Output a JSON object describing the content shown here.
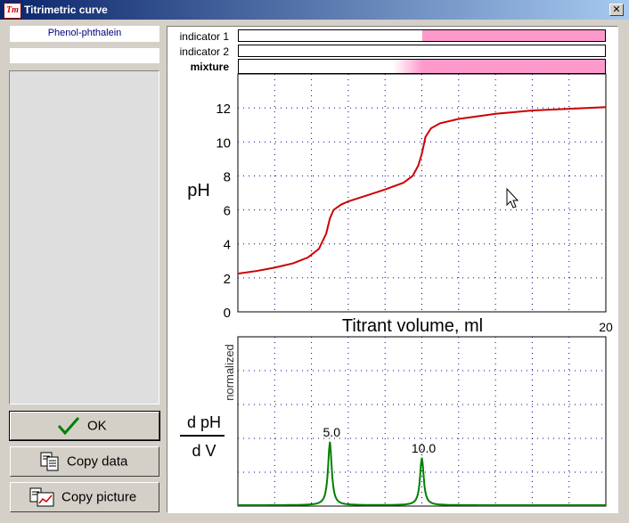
{
  "window": {
    "title": "Titrimetric curve",
    "close_glyph": "✕",
    "app_icon": "Tm"
  },
  "left_panel": {
    "indicator_name": "Phenol-phthalein",
    "ok_label": "OK",
    "copy_data_label": "Copy data",
    "copy_picture_label": "Copy picture"
  },
  "indicators": {
    "indicator1_label": "indicator 1",
    "indicator2_label": "indicator 2",
    "mixture_label": "mixture",
    "indicator1_color_start_fraction": 0.5,
    "mixture_color_start_fraction": 0.5,
    "color": "#ff99cc"
  },
  "chart_data": [
    {
      "type": "line",
      "ylabel": "pH",
      "xlabel": "Titrant volume, ml",
      "x_max_label": "20",
      "xlim": [
        0,
        20
      ],
      "ylim": [
        0,
        14
      ],
      "yticks": [
        0,
        2,
        4,
        6,
        8,
        10,
        12
      ],
      "grid": true,
      "series": [
        {
          "color": "#cc0000",
          "x": [
            0,
            1,
            2,
            3,
            3.8,
            4.4,
            4.8,
            5.0,
            5.2,
            5.6,
            6,
            7,
            8,
            9,
            9.5,
            9.8,
            10.0,
            10.2,
            10.5,
            11,
            12,
            14,
            16,
            18,
            20
          ],
          "y": [
            2.25,
            2.4,
            2.6,
            2.85,
            3.2,
            3.7,
            4.6,
            5.5,
            6.0,
            6.3,
            6.5,
            6.85,
            7.2,
            7.6,
            8.0,
            8.6,
            9.3,
            10.3,
            10.8,
            11.1,
            11.35,
            11.65,
            11.85,
            11.95,
            12.05
          ]
        }
      ]
    },
    {
      "type": "line",
      "ylabel_left": "dpH / dV",
      "ylabel_numerator": "d pH",
      "ylabel_denominator": "d V",
      "ylabel_rotated": "normalized",
      "xlim": [
        0,
        20
      ],
      "ylim": [
        0,
        1
      ],
      "grid": true,
      "peak_labels": [
        {
          "x": 5.0,
          "text": "5.0"
        },
        {
          "x": 10.0,
          "text": "10.0"
        }
      ],
      "series": [
        {
          "color": "#008000",
          "peaks": [
            {
              "center": 5.0,
              "height": 0.375,
              "width": 0.12
            },
            {
              "center": 10.0,
              "height": 0.28,
              "width": 0.12
            }
          ],
          "baseline": 0.005
        }
      ]
    }
  ]
}
